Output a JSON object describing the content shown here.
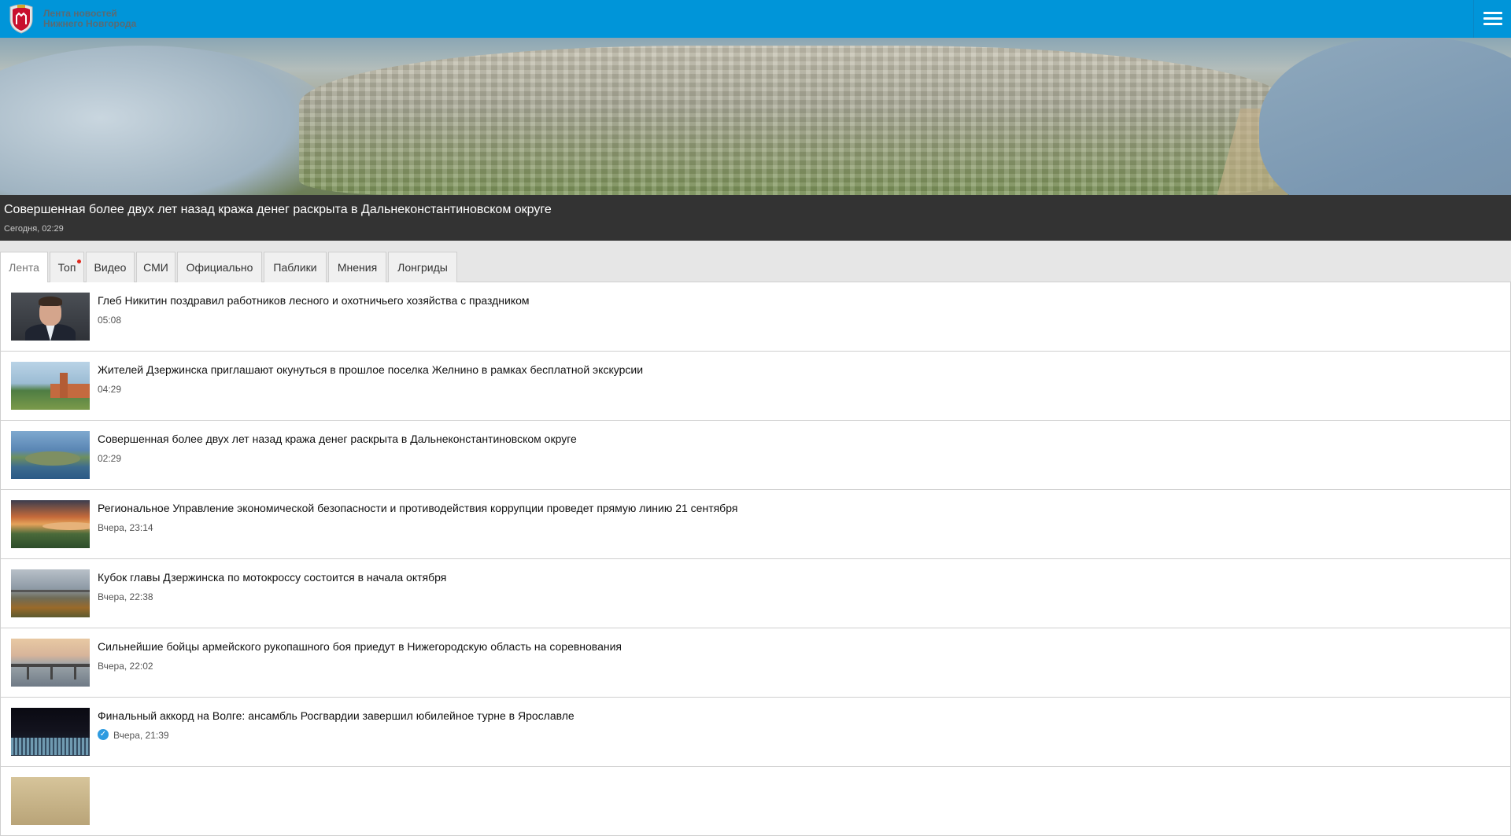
{
  "header": {
    "brand_line1": "Лента новостей",
    "brand_line2": "Нижнего Новгорода",
    "menu_icon": "hamburger-menu-icon",
    "bg_color": "#0095d9"
  },
  "featured": {
    "title": "Совершенная более двух лет назад кража денег раскрыта в Дальнеконстантиновском округе",
    "time": "Сегодня, 02:29"
  },
  "tabs": [
    {
      "label": "Лента",
      "active": true
    },
    {
      "label": "Топ",
      "badge": true
    },
    {
      "label": "Видео"
    },
    {
      "label": "СМИ"
    },
    {
      "label": "Официально"
    },
    {
      "label": "Паблики"
    },
    {
      "label": "Мнения"
    },
    {
      "label": "Лонгриды"
    }
  ],
  "feed": [
    {
      "title": "Глеб Никитин поздравил работников лесного и охотничьего хозяйства с праздником",
      "time": "05:08"
    },
    {
      "title": "Жителей Дзержинска приглашают окунуться в прошлое поселка Желнино в рамках бесплатной экскурсии",
      "time": "04:29"
    },
    {
      "title": "Совершенная более двух лет назад кража денег раскрыта в Дальнеконстантиновском округе",
      "time": "02:29"
    },
    {
      "title": "Региональное Управление экономической безопасности и противодействия коррупции проведет прямую линию 21 сентября",
      "time": "Вчера, 23:14"
    },
    {
      "title": "Кубок главы Дзержинска по мотокроссу состоится в начала октября",
      "time": "Вчера, 22:38"
    },
    {
      "title": "Сильнейшие бойцы армейского рукопашного боя приедут в Нижегородскую область на соревнования",
      "time": "Вчера, 22:02"
    },
    {
      "title": "Финальный аккорд на Волге: ансамбль Росгвардии завершил юбилейное турне в Ярославле",
      "time": "Вчера, 21:39",
      "verified": true
    }
  ],
  "colors": {
    "accent": "#0095d9",
    "badge": "#e0281d",
    "verified": "#2e9be0",
    "headline_bg": "#333333"
  }
}
